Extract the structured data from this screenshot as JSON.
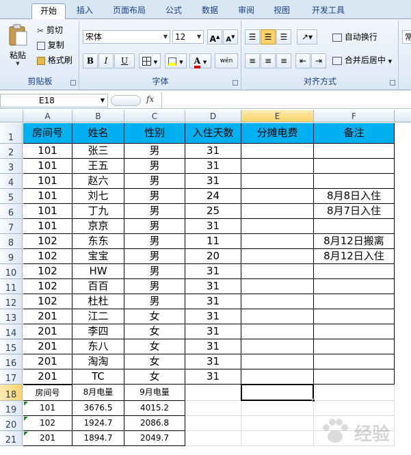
{
  "ribbon": {
    "tabs": [
      {
        "label": "开始",
        "active": true
      },
      {
        "label": "插入",
        "active": false
      },
      {
        "label": "页面布局",
        "active": false
      },
      {
        "label": "公式",
        "active": false
      },
      {
        "label": "数据",
        "active": false
      },
      {
        "label": "审阅",
        "active": false
      },
      {
        "label": "视图",
        "active": false
      },
      {
        "label": "开发工具",
        "active": false
      }
    ],
    "clipboard": {
      "paste": "粘贴",
      "cut": "剪切",
      "copy": "复制",
      "format_painter": "格式刷",
      "label": "剪贴板"
    },
    "font": {
      "name": "宋体",
      "size": "12",
      "label": "字体",
      "bold": "B",
      "italic": "I",
      "underline": "U",
      "grow": "A",
      "shrink": "A",
      "phonetic": "wén"
    },
    "alignment": {
      "wrap": "自动换行",
      "merge": "合并后居中",
      "label": "对齐方式"
    },
    "number": {
      "format_partial": "常"
    }
  },
  "formula_bar": {
    "name_box": "E18",
    "fx": "fx",
    "formula": ""
  },
  "sheet": {
    "columns": [
      "A",
      "B",
      "C",
      "D",
      "E",
      "F"
    ],
    "selected_column": "E",
    "selected_row": 18,
    "rows": [
      {
        "n": "1",
        "a": "房间号",
        "b": "姓名",
        "c": "性别",
        "d": "入住天数",
        "e": "分摊电费",
        "f": "备注"
      },
      {
        "n": "2",
        "a": "101",
        "b": "张三",
        "c": "男",
        "d": "31",
        "e": "",
        "f": ""
      },
      {
        "n": "3",
        "a": "101",
        "b": "王五",
        "c": "男",
        "d": "31",
        "e": "",
        "f": ""
      },
      {
        "n": "4",
        "a": "101",
        "b": "赵六",
        "c": "男",
        "d": "31",
        "e": "",
        "f": ""
      },
      {
        "n": "5",
        "a": "101",
        "b": "刘七",
        "c": "男",
        "d": "24",
        "e": "",
        "f": "8月8日入住"
      },
      {
        "n": "6",
        "a": "101",
        "b": "丁九",
        "c": "男",
        "d": "25",
        "e": "",
        "f": "8月7日入住"
      },
      {
        "n": "7",
        "a": "101",
        "b": "京京",
        "c": "男",
        "d": "31",
        "e": "",
        "f": ""
      },
      {
        "n": "8",
        "a": "102",
        "b": "东东",
        "c": "男",
        "d": "11",
        "e": "",
        "f": "8月12日搬离"
      },
      {
        "n": "9",
        "a": "102",
        "b": "宝宝",
        "c": "男",
        "d": "20",
        "e": "",
        "f": "8月12日入住"
      },
      {
        "n": "10",
        "a": "102",
        "b": "HW",
        "c": "男",
        "d": "31",
        "e": "",
        "f": ""
      },
      {
        "n": "11",
        "a": "102",
        "b": "百百",
        "c": "男",
        "d": "31",
        "e": "",
        "f": ""
      },
      {
        "n": "12",
        "a": "102",
        "b": "杜杜",
        "c": "男",
        "d": "31",
        "e": "",
        "f": ""
      },
      {
        "n": "13",
        "a": "201",
        "b": "江二",
        "c": "女",
        "d": "31",
        "e": "",
        "f": ""
      },
      {
        "n": "14",
        "a": "201",
        "b": "李四",
        "c": "女",
        "d": "31",
        "e": "",
        "f": ""
      },
      {
        "n": "15",
        "a": "201",
        "b": "东八",
        "c": "女",
        "d": "31",
        "e": "",
        "f": ""
      },
      {
        "n": "16",
        "a": "201",
        "b": "淘淘",
        "c": "女",
        "d": "31",
        "e": "",
        "f": ""
      },
      {
        "n": "17",
        "a": "201",
        "b": "TC",
        "c": "女",
        "d": "31",
        "e": "",
        "f": ""
      },
      {
        "n": "18",
        "a": "房间号",
        "b": "8月电量",
        "c": "9月电量",
        "d": "",
        "e": "",
        "f": ""
      },
      {
        "n": "19",
        "a": "101",
        "b": "3676.5",
        "c": "4015.2",
        "d": "",
        "e": "",
        "f": ""
      },
      {
        "n": "20",
        "a": "102",
        "b": "1924.7",
        "c": "2086.8",
        "d": "",
        "e": "",
        "f": ""
      },
      {
        "n": "21",
        "a": "201",
        "b": "1894.7",
        "c": "2049.7",
        "d": "",
        "e": "",
        "f": ""
      }
    ]
  },
  "watermark": {
    "text": "经验"
  },
  "colors": {
    "header_fill": "#00b0f0",
    "selection_orange": "#f9d56a",
    "ribbon_blue": "#15428b"
  }
}
